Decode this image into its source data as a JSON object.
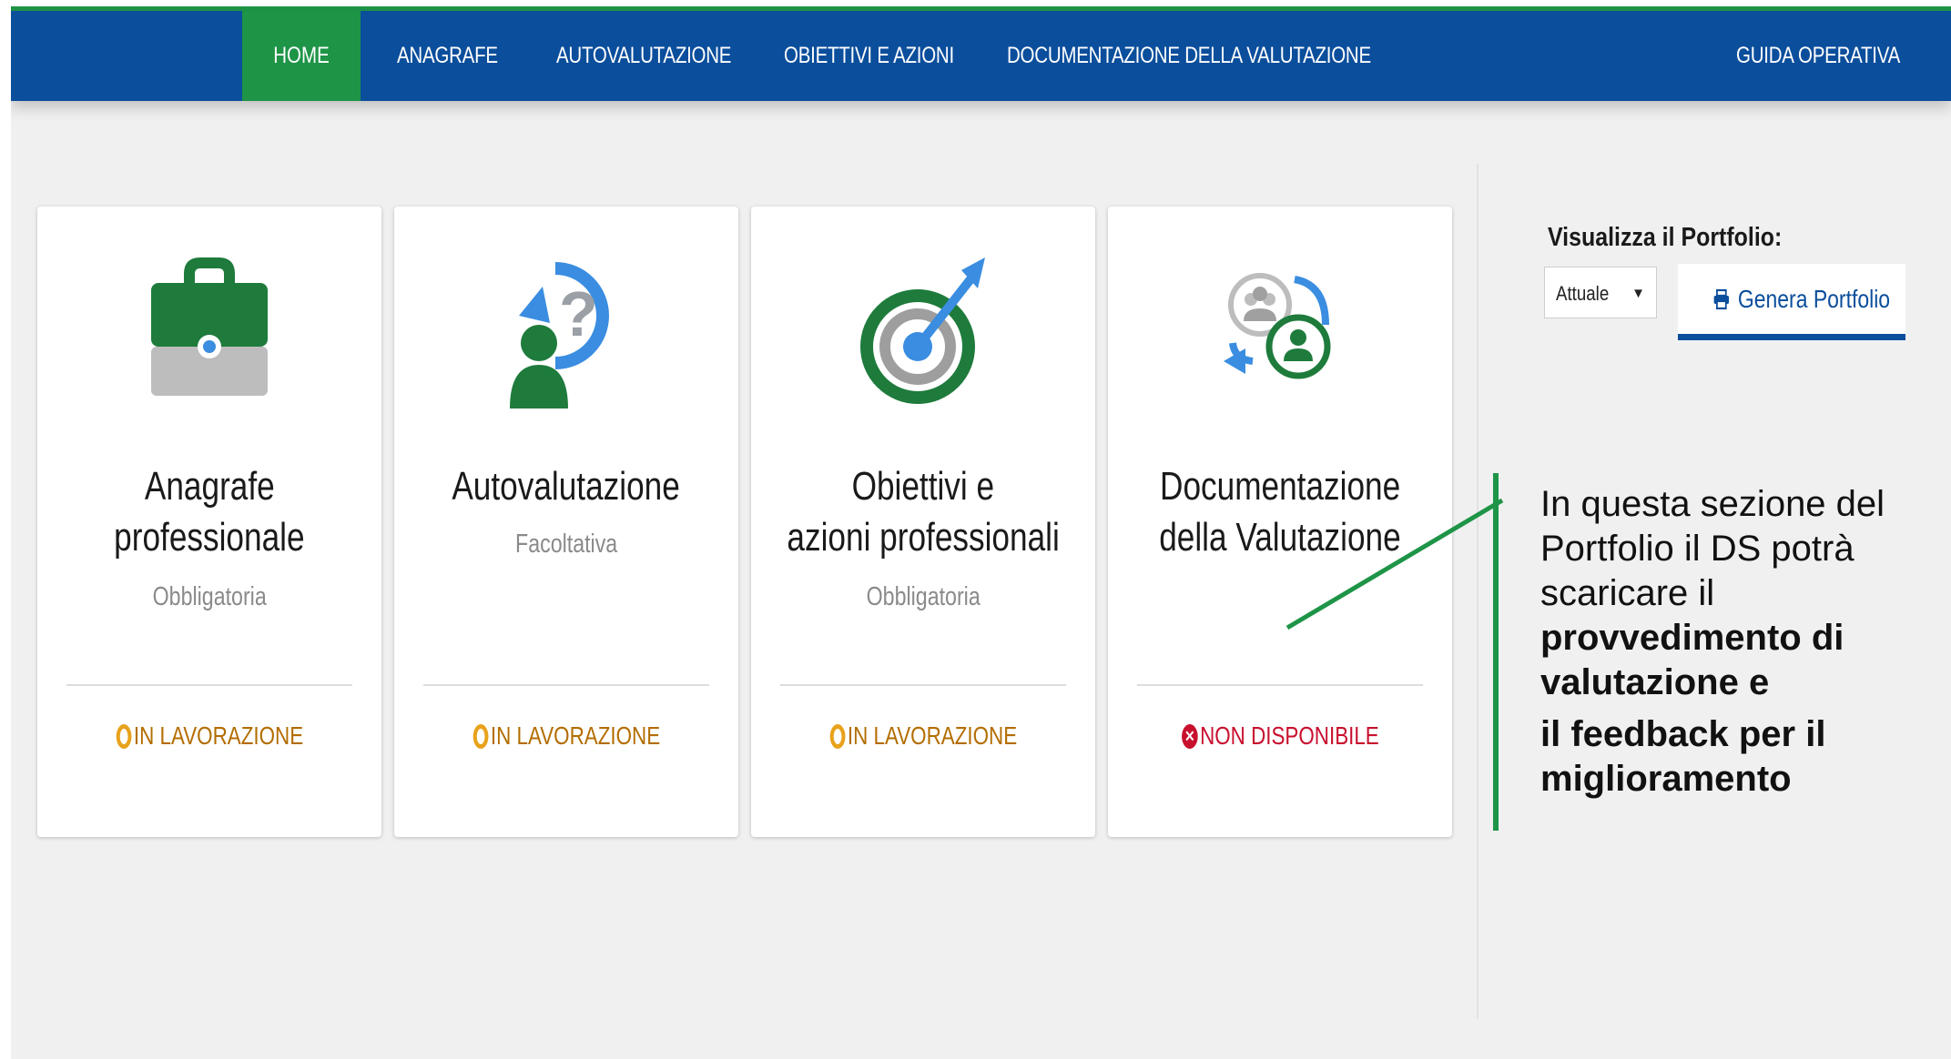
{
  "nav": {
    "home": "HOME",
    "items": [
      "ANAGRAFE",
      "AUTOVALUTAZIONE",
      "OBIETTIVI E AZIONI",
      "DOCUMENTAZIONE DELLA VALUTAZIONE"
    ],
    "guide": "GUIDA OPERATIVA"
  },
  "cards": [
    {
      "title1": "Anagrafe",
      "title2": "professionale",
      "sub": "Obbligatoria",
      "status": "IN LAVORAZIONE",
      "status_type": "in-progress",
      "icon": "briefcase-icon"
    },
    {
      "title1": "Autovalutazione",
      "title2": "",
      "sub": "Facoltativa",
      "status": "IN LAVORAZIONE",
      "status_type": "in-progress",
      "icon": "self-evaluation-icon"
    },
    {
      "title1": "Obiettivi e",
      "title2": "azioni professionali",
      "sub": "Obbligatoria",
      "status": "IN LAVORAZIONE",
      "status_type": "in-progress",
      "icon": "target-icon"
    },
    {
      "title1": "Documentazione",
      "title2": "della Valutazione",
      "sub": "",
      "status": "NON DISPONIBILE",
      "status_type": "unavailable",
      "icon": "evaluation-documents-icon"
    }
  ],
  "portfolio": {
    "label": "Visualizza il Portfolio:",
    "select_value": "Attuale",
    "button": "Genera Portfolio"
  },
  "annotation": {
    "line1": "In questa sezione del",
    "line2": "Portfolio il DS potrà",
    "line3": "scaricare il",
    "bold1": "provvedimento di",
    "bold2": "valutazione e",
    "bold3": "il feedback per il",
    "bold4": "miglioramento"
  },
  "colors": {
    "nav_blue": "#0b4e9c",
    "green": "#1e9447",
    "orange": "#e8a21c",
    "red": "#c8102e"
  }
}
